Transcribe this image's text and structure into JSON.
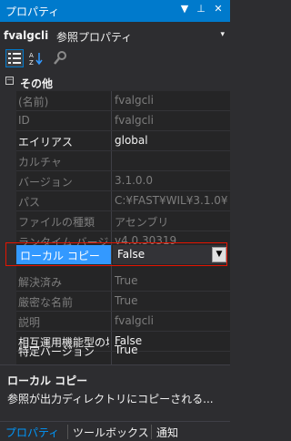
{
  "window": {
    "title": "プロパティ",
    "dropdown_glyph": "▼",
    "pin_glyph": "⊥",
    "close_glyph": "✕"
  },
  "object_selector": {
    "name": "fvalgcli",
    "type": "参照プロパティ",
    "arrow": "▾"
  },
  "toolbar": {
    "buttons": [
      {
        "icon": "categorized-icon",
        "active": true
      },
      {
        "icon": "alphabetical-icon",
        "active": false
      },
      {
        "icon": "wrench-icon",
        "active": false
      }
    ]
  },
  "grid": {
    "category": {
      "label": "その他",
      "toggle": "−"
    },
    "rows": [
      {
        "name": "(名前)",
        "value": "fvalgcli",
        "readonly": true
      },
      {
        "name": "ID",
        "value": "fvalgcli",
        "readonly": true
      },
      {
        "name": "エイリアス",
        "value": "global",
        "readonly": false
      },
      {
        "name": "カルチャ",
        "value": "",
        "readonly": true
      },
      {
        "name": "バージョン",
        "value": "3.1.0.0",
        "readonly": true
      },
      {
        "name": "パス",
        "value": "C:¥FAST¥WIL¥3.1.0¥",
        "readonly": true
      },
      {
        "name": "ファイルの種類",
        "value": "アセンブリ",
        "readonly": true
      },
      {
        "name": "ランタイム バージ",
        "value": "v4.0.30319",
        "readonly": true
      },
      {
        "name": "ローカル コピー",
        "value": "False",
        "readonly": false,
        "selected": true
      },
      {
        "name": "解決済み",
        "value": "True",
        "readonly": true
      },
      {
        "name": "厳密な名前",
        "value": "True",
        "readonly": true
      },
      {
        "name": "説明",
        "value": "fvalgcli",
        "readonly": true
      },
      {
        "name": "相互運用機能型の埋",
        "value": "False",
        "readonly": false
      },
      {
        "name": "特定バージョン",
        "value": "True",
        "readonly": false
      }
    ],
    "dropdown_glyph": "▼"
  },
  "description": {
    "title": "ローカル コピー",
    "text": "参照が出力ディレクトリにコピーされる..."
  },
  "tabs": [
    {
      "label": "プロパティ",
      "active": true
    },
    {
      "label": "ツールボックス",
      "active": false
    },
    {
      "label": "通知",
      "active": false
    }
  ],
  "colors": {
    "accent": "#007acc",
    "selection": "#3399ff",
    "highlight_border": "#e51400",
    "background": "#252526",
    "readonly_text": "#7d7d7d"
  }
}
